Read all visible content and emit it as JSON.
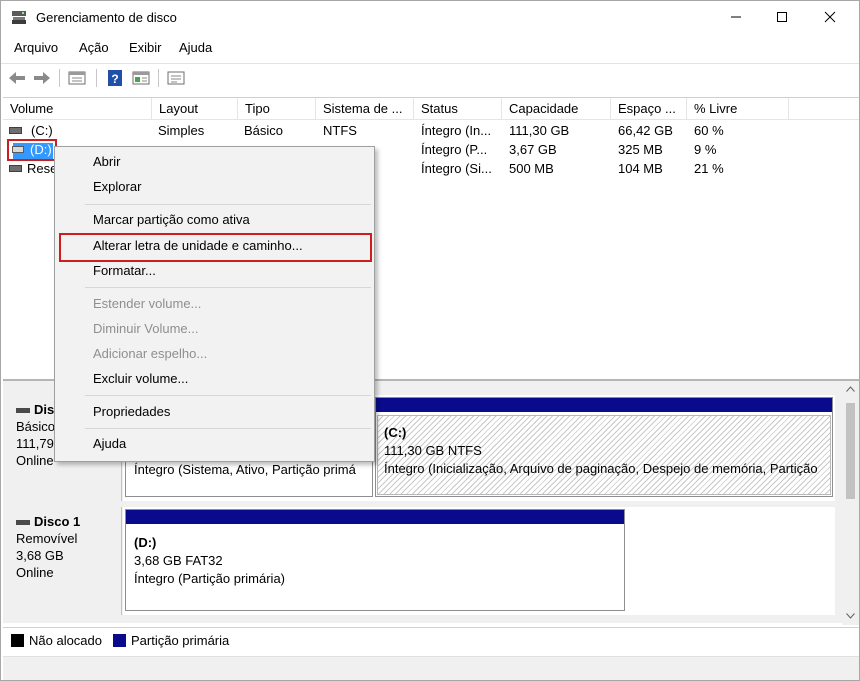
{
  "window": {
    "title": "Gerenciamento de disco"
  },
  "menu": [
    "Arquivo",
    "Ação",
    "Exibir",
    "Ajuda"
  ],
  "toolbar": {
    "icons": [
      "back-icon",
      "forward-icon",
      "properties-icon",
      "help-icon",
      "view-icon",
      "console-icon"
    ]
  },
  "columns": [
    "Volume",
    "Layout",
    "Tipo",
    "Sistema de ...",
    "Status",
    "Capacidade",
    "Espaço ...",
    "% Livre"
  ],
  "rows": [
    {
      "volume": "(C:)",
      "layout": "Simples",
      "type": "Básico",
      "fs": "NTFS",
      "status": "Íntegro (In...",
      "capacity": "111,30 GB",
      "free": "66,42 GB",
      "pct": "60 %"
    },
    {
      "volume": "(D:)",
      "layout": "",
      "type": "",
      "fs": "",
      "status": "Íntegro (P...",
      "capacity": "3,67 GB",
      "free": "325 MB",
      "pct": "9 %"
    },
    {
      "volume": "Rese",
      "layout": "",
      "type": "",
      "fs": "",
      "status": "Íntegro (Si...",
      "capacity": "500 MB",
      "free": "104 MB",
      "pct": "21 %"
    }
  ],
  "context_menu": {
    "items": [
      {
        "label": "Abrir",
        "enabled": true
      },
      {
        "label": "Explorar",
        "enabled": true
      },
      {
        "label": "Marcar partição como ativa",
        "enabled": true
      },
      {
        "label": "Alterar letra de unidade e caminho...",
        "enabled": true
      },
      {
        "label": "Formatar...",
        "enabled": true
      },
      {
        "label": "Estender volume...",
        "enabled": false
      },
      {
        "label": "Diminuir Volume...",
        "enabled": false
      },
      {
        "label": "Adicionar espelho...",
        "enabled": false
      },
      {
        "label": "Excluir volume...",
        "enabled": true
      },
      {
        "label": "Propriedades",
        "enabled": true
      },
      {
        "label": "Ajuda",
        "enabled": true
      }
    ]
  },
  "disks": [
    {
      "name": "Disc",
      "type": "Básico",
      "size": "111,79",
      "status": "Online",
      "partition_left_status": "Íntegro (Sistema, Ativo, Partição primá",
      "partition_right": {
        "name": "(C:)",
        "size": "111,30 GB NTFS",
        "status": "Íntegro (Inicialização, Arquivo de paginação, Despejo de memória, Partição"
      }
    },
    {
      "name": "Disco 1",
      "type": "Removível",
      "size": "3,68 GB",
      "status": "Online",
      "partition": {
        "name": "(D:)",
        "size": "3,68 GB FAT32",
        "status": "Íntegro (Partição primária)"
      }
    }
  ],
  "legend": [
    {
      "label": "Não alocado",
      "color": "#000000"
    },
    {
      "label": "Partição primária",
      "color": "#0a0a8c"
    }
  ],
  "colors": {
    "highlight": "#cc1e1e",
    "selection": "#3399ff",
    "partition_bar": "#0a0a8c"
  }
}
